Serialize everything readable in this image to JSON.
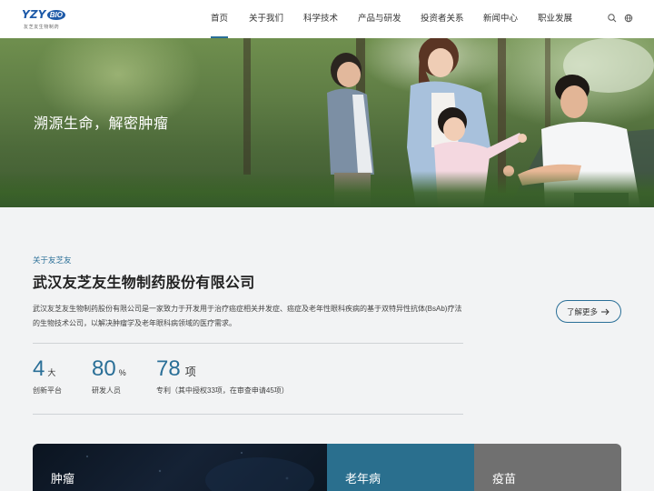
{
  "header": {
    "logo": {
      "mark": "YZY",
      "badge": "BIO",
      "subtitle": "友芝友生物制药"
    },
    "nav": [
      {
        "label": "首页",
        "active": true
      },
      {
        "label": "关于我们"
      },
      {
        "label": "科学技术"
      },
      {
        "label": "产品与研发"
      },
      {
        "label": "投资者关系"
      },
      {
        "label": "新闻中心"
      },
      {
        "label": "职业发展"
      }
    ],
    "icons": [
      "search-icon",
      "globe-icon"
    ]
  },
  "hero": {
    "title": "溯源生命，解密肿瘤"
  },
  "about": {
    "eyebrow": "关于友芝友",
    "title": "武汉友芝友生物制药股份有限公司",
    "description": "武汉友芝友生物制药股份有限公司是一家致力于开发用于治疗癌症相关并发症、癌症及老年性眼科疾病的基于双特异性抗体(BsAb)疗法的生物技术公司，以解决肿瘤学及老年眼科病领域的医疗需求。",
    "more_label": "了解更多",
    "stats": [
      {
        "value": "4",
        "unit": "大",
        "label": "创新平台"
      },
      {
        "value": "80",
        "unit": "%",
        "label": "研发人员"
      },
      {
        "value": "78",
        "unit": "项",
        "label": "专利（其中授权33项，在审查申请45项）"
      }
    ]
  },
  "cards": [
    {
      "label": "肿瘤"
    },
    {
      "label": "老年病"
    },
    {
      "label": "疫苗"
    }
  ],
  "colors": {
    "accent": "#2a6f97",
    "card_aging": "#2a6f8e",
    "card_vaccine": "#707070",
    "card_tumor": "#0b1420"
  }
}
